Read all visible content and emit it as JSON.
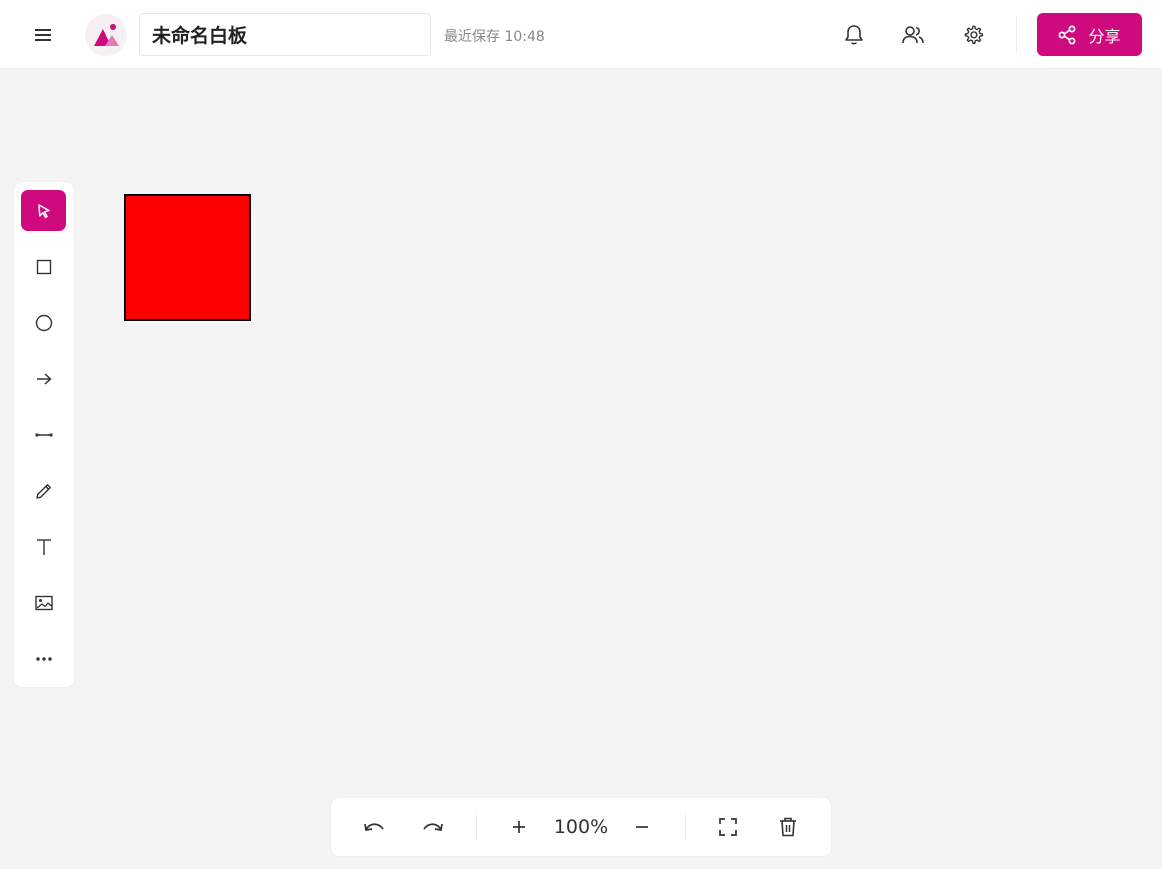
{
  "header": {
    "title_value": "未命名白板",
    "save_status": "最近保存 10:48",
    "share_label": "分享"
  },
  "icons": {
    "menu": "menu-icon",
    "logo": "app-logo",
    "bell": "bell-icon",
    "users": "users-icon",
    "settings": "gear-icon",
    "share": "share-icon"
  },
  "tools": [
    {
      "name": "select",
      "icon": "cursor-icon",
      "active": true
    },
    {
      "name": "rectangle",
      "icon": "square-icon",
      "active": false
    },
    {
      "name": "circle",
      "icon": "circle-icon",
      "active": false
    },
    {
      "name": "arrow",
      "icon": "arrow-right-icon",
      "active": false
    },
    {
      "name": "line",
      "icon": "line-icon",
      "active": false
    },
    {
      "name": "pencil",
      "icon": "pencil-icon",
      "active": false
    },
    {
      "name": "text",
      "icon": "text-icon",
      "active": false
    },
    {
      "name": "image",
      "icon": "image-icon",
      "active": false
    },
    {
      "name": "more",
      "icon": "more-icon",
      "active": false
    }
  ],
  "canvas": {
    "shapes": [
      {
        "type": "rectangle",
        "fill": "#ff0000",
        "stroke": "#000000"
      }
    ]
  },
  "bottombar": {
    "zoom_level": "100%"
  },
  "colors": {
    "accent": "#cf0a7e",
    "background": "#f4f4f4"
  }
}
